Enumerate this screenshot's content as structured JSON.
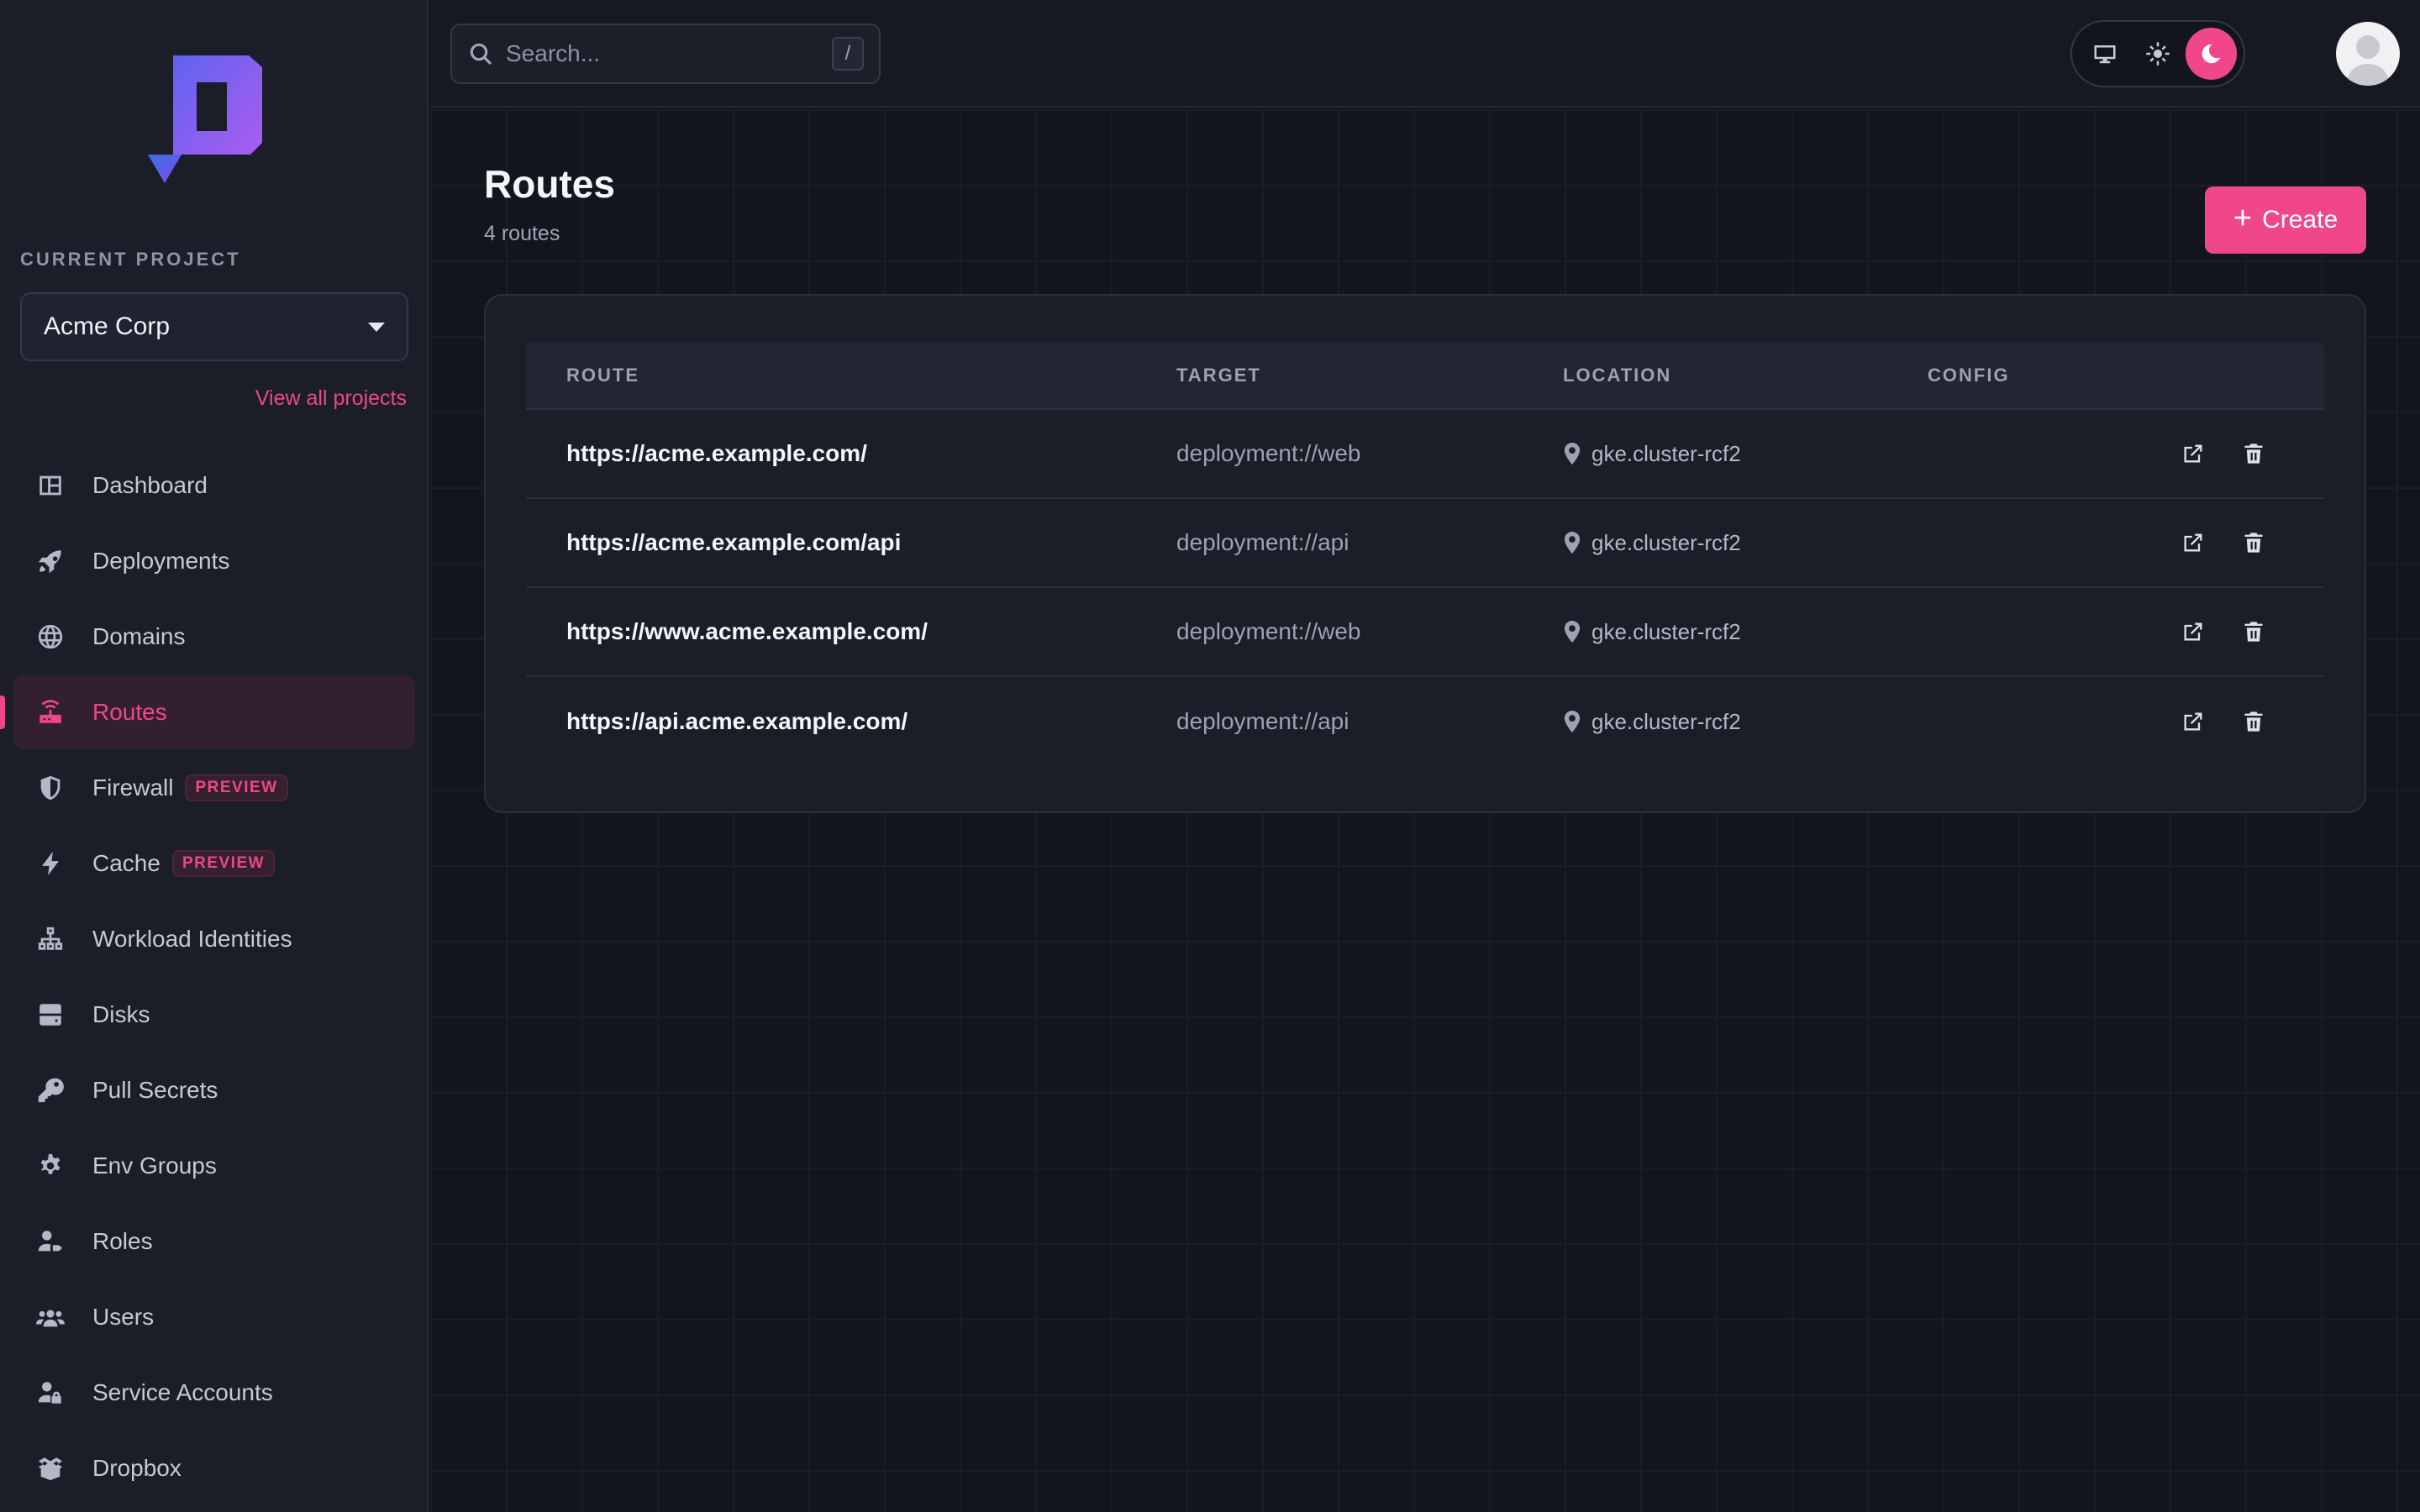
{
  "sidebar": {
    "current_project_label": "CURRENT PROJECT",
    "project": "Acme Corp",
    "view_all": "View all projects",
    "items": [
      {
        "label": "Dashboard",
        "icon": "dashboard-icon"
      },
      {
        "label": "Deployments",
        "icon": "rocket-icon"
      },
      {
        "label": "Domains",
        "icon": "globe-icon"
      },
      {
        "label": "Routes",
        "icon": "router-icon",
        "active": true
      },
      {
        "label": "Firewall",
        "icon": "shield-icon",
        "badge": "PREVIEW"
      },
      {
        "label": "Cache",
        "icon": "bolt-icon",
        "badge": "PREVIEW"
      },
      {
        "label": "Workload Identities",
        "icon": "network-icon"
      },
      {
        "label": "Disks",
        "icon": "disk-icon"
      },
      {
        "label": "Pull Secrets",
        "icon": "key-icon"
      },
      {
        "label": "Env Groups",
        "icon": "gear-icon"
      },
      {
        "label": "Roles",
        "icon": "user-tag-icon"
      },
      {
        "label": "Users",
        "icon": "users-icon"
      },
      {
        "label": "Service Accounts",
        "icon": "user-lock-icon"
      },
      {
        "label": "Dropbox",
        "icon": "box-icon"
      }
    ]
  },
  "topbar": {
    "search_placeholder": "Search...",
    "search_shortcut": "/",
    "theme_modes": [
      "system",
      "light",
      "dark"
    ],
    "theme_selected": "dark"
  },
  "main": {
    "title": "Routes",
    "subtitle": "4 routes",
    "create_label": "Create",
    "columns": [
      "ROUTE",
      "TARGET",
      "LOCATION",
      "CONFIG"
    ],
    "rows": [
      {
        "route": "https://acme.example.com/",
        "target": "deployment://web",
        "location": "gke.cluster-rcf2"
      },
      {
        "route": "https://acme.example.com/api",
        "target": "deployment://api",
        "location": "gke.cluster-rcf2"
      },
      {
        "route": "https://www.acme.example.com/",
        "target": "deployment://web",
        "location": "gke.cluster-rcf2"
      },
      {
        "route": "https://api.acme.example.com/",
        "target": "deployment://api",
        "location": "gke.cluster-rcf2"
      }
    ]
  },
  "colors": {
    "accent": "#f0468c",
    "background": "#13151e",
    "sidebar": "#1b1d28"
  }
}
